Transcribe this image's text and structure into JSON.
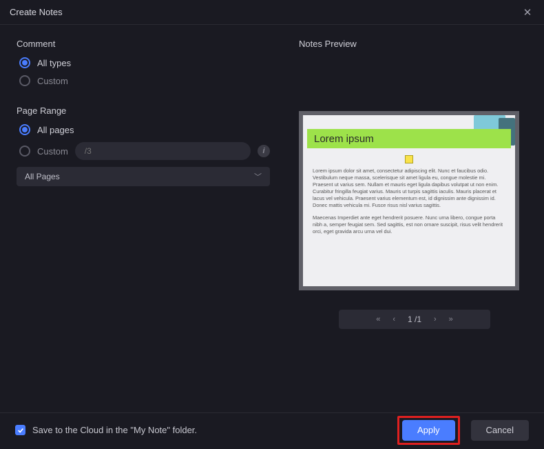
{
  "title": "Create Notes",
  "left": {
    "comment_label": "Comment",
    "all_types": "All types",
    "custom_types": "Custom",
    "page_range_label": "Page Range",
    "all_pages": "All pages",
    "custom_pages": "Custom",
    "page_input_placeholder": "/3",
    "select_value": "All Pages"
  },
  "right": {
    "preview_label": "Notes Preview",
    "green_title": "Lorem ipsum",
    "para1": "Lorem ipsum dolor sit amet, consectetur adipiscing elit. Nunc et faucibus odio. Vestibulum neque massa, scelerisque sit amet ligula eu, congue molestie mi. Praesent ut varius sem. Nullam et mauris eget ligula dapibus volutpat ut non enim. Curabitur fringilla feugiat varius. Mauris ut turpis sagittis iaculis. Mauris placerat et lacus vel vehicula. Praesent varius elementum est, id dignissim ante dignissim id. Donec mattis vehicula mi. Fusce risus nisl varius sagittis.",
    "para2": "Maecenas Imperdiet ante eget hendrerit posuere. Nunc urna libero, congue porta nibh a, semper feugiat sem. Sed sagittis, est non ornare suscipit, risus velit hendrerit orci, eget gravida arcu urna vel dui.",
    "pager_value": "1 /1"
  },
  "footer": {
    "save_cloud": "Save to the Cloud in the \"My Note\" folder.",
    "apply": "Apply",
    "cancel": "Cancel"
  }
}
